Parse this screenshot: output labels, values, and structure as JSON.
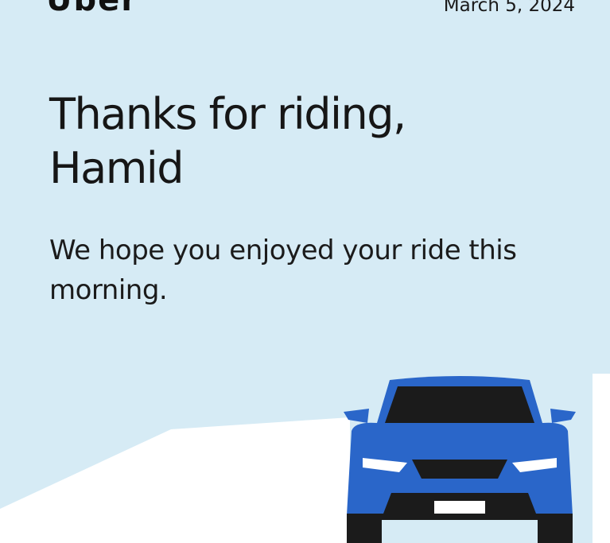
{
  "header": {
    "brand": "Uber",
    "date": "March 5, 2024"
  },
  "hero": {
    "headline_line1": "Thanks for riding,",
    "headline_line2": "Hamid",
    "message_line1": "We hope you enjoyed your ride this",
    "message_line2": "morning."
  },
  "illustration": {
    "icon": "car-front-icon",
    "background_color": "#d6ebf5",
    "car_color": "#2a66c9",
    "car_dark": "#1b1b1b"
  }
}
